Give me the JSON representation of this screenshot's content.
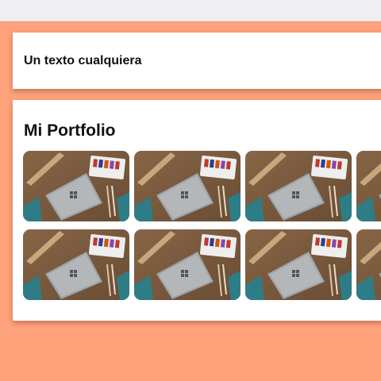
{
  "browser": {
    "top_bar": ""
  },
  "intro": {
    "text": "Un texto cualquiera"
  },
  "portfolio": {
    "title": "Mi Portfolio",
    "images": [
      {
        "name": "laptop-desk-photo"
      },
      {
        "name": "laptop-desk-photo"
      },
      {
        "name": "laptop-desk-photo"
      },
      {
        "name": "laptop-desk-photo"
      },
      {
        "name": "laptop-desk-photo"
      },
      {
        "name": "laptop-desk-photo"
      },
      {
        "name": "laptop-desk-photo"
      },
      {
        "name": "laptop-desk-photo"
      }
    ],
    "colors": {
      "desk_wood": "#7a5a3e",
      "laptop": "#9ea3a7",
      "paint_tray": "#eeeeee",
      "tube_wood": "#c9a77c",
      "teal_accent": "#2e7d86"
    }
  },
  "page": {
    "background": "#ffa17a"
  }
}
